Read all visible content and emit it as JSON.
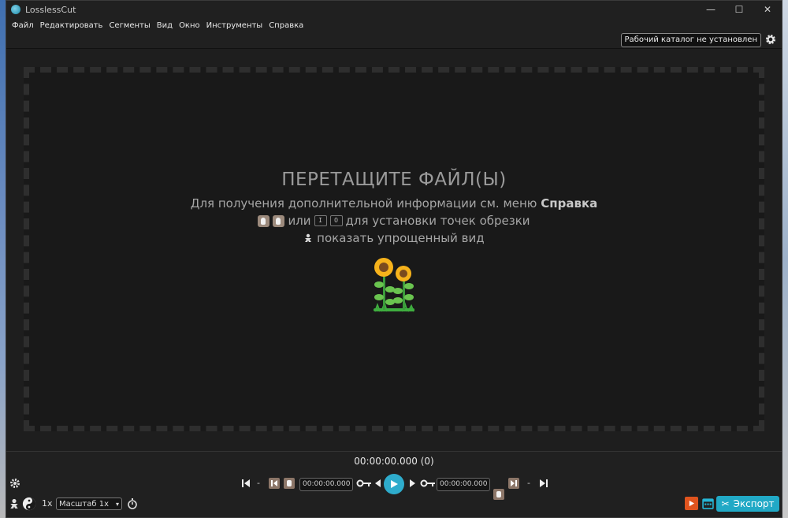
{
  "window": {
    "title": "LosslessCut",
    "minimize": "—",
    "maximize": "☐",
    "close": "✕"
  },
  "menu": [
    "Файл",
    "Редактировать",
    "Сегменты",
    "Вид",
    "Окно",
    "Инструменты",
    "Справка"
  ],
  "topbar": {
    "working_dir_label": "Рабочий каталог не установлен"
  },
  "dropzone": {
    "title": "ПЕРЕТАЩИТЕ ФАЙЛ(Ы)",
    "help_prefix": "Для получения дополнительной информации см. меню",
    "help_bold": "Справка",
    "or_text": "или",
    "key_in": "I",
    "key_out": "O",
    "cut_points_text": "для установки точек обрезки",
    "simple_view_text": "показать упрощенный вид"
  },
  "timeline": {
    "current_time": "00:00:00.000 (0)"
  },
  "controls": {
    "start_time": "00:00:00.000",
    "end_time": "00:00:00.000",
    "dash_left": "-",
    "dash_right": "-"
  },
  "bottom": {
    "speed": "1x",
    "zoom_value": "Масштаб 1x",
    "export_label": "Экспорт"
  },
  "colors": {
    "accent": "#21a9c6",
    "background": "#1e1e1e"
  }
}
